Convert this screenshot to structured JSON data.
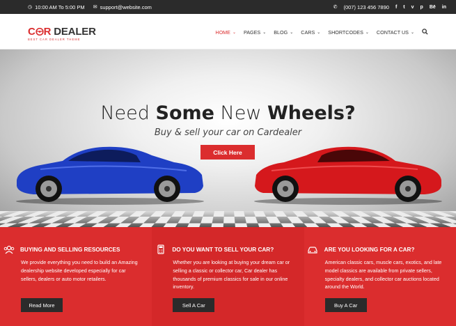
{
  "topbar": {
    "hours": "10:00 AM To 5:00 PM",
    "email": "support@website.com",
    "phone": "(007) 123 456 7890",
    "social": [
      "f",
      "t",
      "v",
      "p",
      "Bē",
      "in"
    ],
    "icons": [
      "clock-icon",
      "mail-icon",
      "phone-icon"
    ]
  },
  "logo": {
    "part1": "C",
    "part1b": "R",
    "part2": "DEALER",
    "tagline": "BEST CAR DEALER THEME"
  },
  "nav": {
    "items": [
      {
        "label": "HOME",
        "active": true
      },
      {
        "label": "PAGES"
      },
      {
        "label": "BLOG"
      },
      {
        "label": "CARS"
      },
      {
        "label": "SHORTCODES"
      },
      {
        "label": "CONTACT US"
      }
    ],
    "search_icon": "search-icon"
  },
  "hero": {
    "headline_part1": "Need ",
    "headline_bold1": "Some",
    "headline_part2": " New ",
    "headline_bold2": "Wheels?",
    "subline": "Buy & sell your car on Cardealer",
    "cta": "Click Here",
    "colors": {
      "left_car": "#1f3fc4",
      "right_car": "#d5181c"
    }
  },
  "features": [
    {
      "icon": "people-icon",
      "title": "BUYING AND SELLING RESOURCES",
      "text": "We provide everything you need to build an Amazing dealership website developed especially for car sellers, dealers or auto motor retailers.",
      "button": "Read More"
    },
    {
      "icon": "car-calculator-icon",
      "title": "DO YOU WANT TO SELL YOUR CAR?",
      "text": "Whether you are looking at buying your dream car or selling a classic or collector car, Car dealer has thousands of premium classics for sale in our online inventory.",
      "button": "Sell A Car"
    },
    {
      "icon": "car-icon",
      "title": "ARE YOU LOOKING FOR A CAR?",
      "text": "American classic cars, muscle cars, exotics, and late model classics are available from private sellers, specialty dealers, and collector car auctions located around the World.",
      "button": "Buy A Car"
    }
  ],
  "colors": {
    "accent": "#db2d2e",
    "dark": "#2b2b2b"
  }
}
